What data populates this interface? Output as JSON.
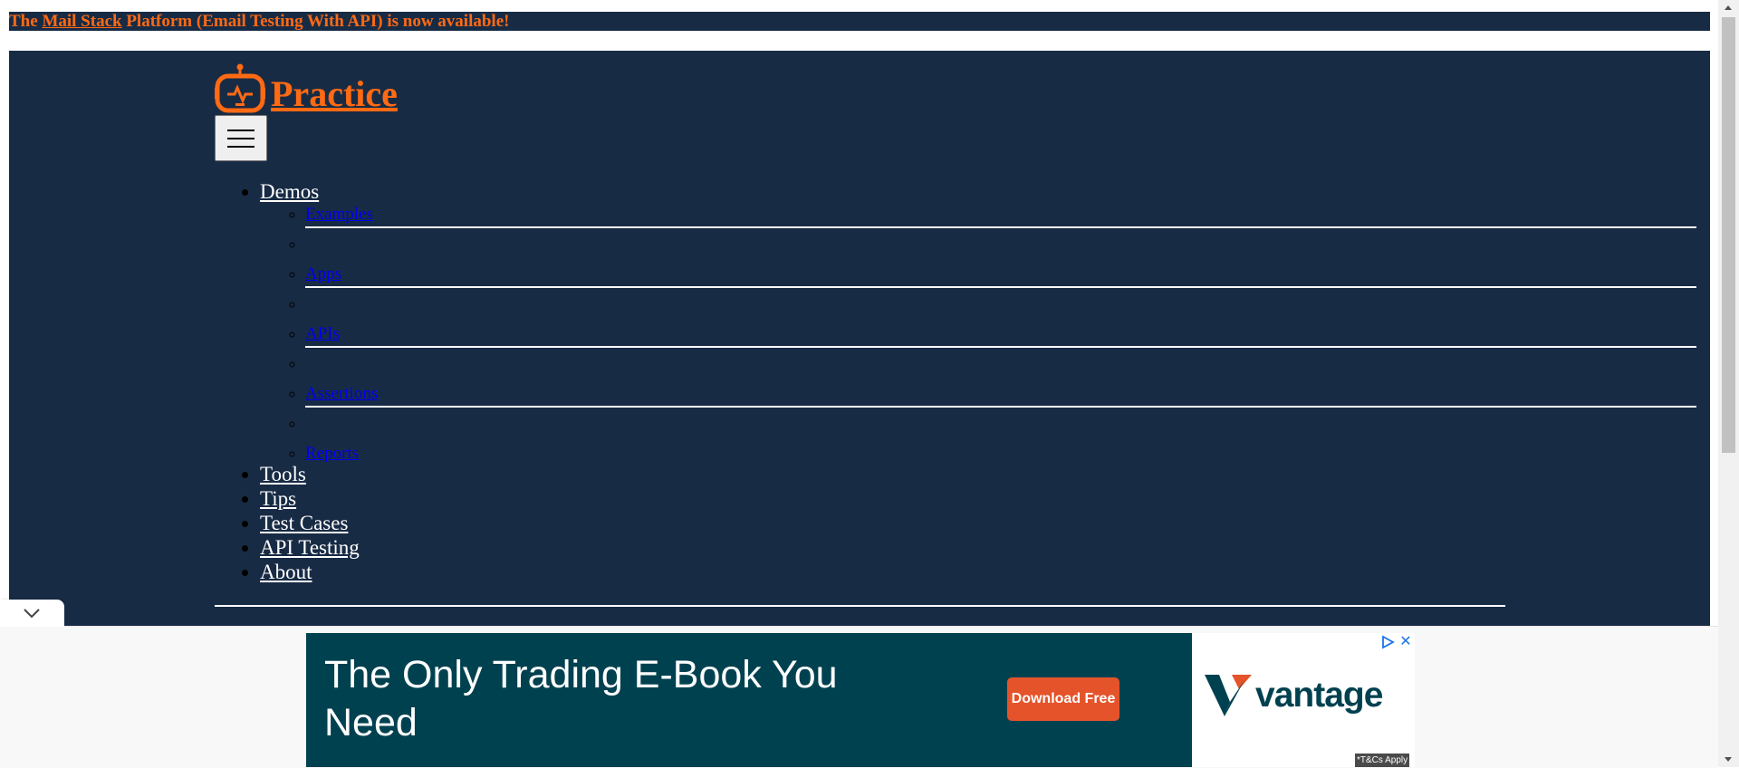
{
  "announcement": {
    "prefix": "The",
    "link": "Mail Stack",
    "suffix": "Platform (Email Testing With API) is now available!"
  },
  "header": {
    "brand": "Practice",
    "menu_toggle_icon": "hamburger-icon",
    "nav": [
      {
        "label": "Demos",
        "submenu": [
          "Examples",
          "Apps",
          "APIs",
          "Assertions",
          "Reports"
        ]
      },
      {
        "label": "Tools"
      },
      {
        "label": "Tips"
      },
      {
        "label": "Test Cases"
      },
      {
        "label": "API Testing"
      },
      {
        "label": "About"
      }
    ]
  },
  "collapse_tab": {
    "icon": "chevron-down-icon"
  },
  "ad": {
    "headline": "The Only Trading E-Book You Need",
    "cta": "Download Free",
    "brand": "vantage",
    "terms": "*T&Cs Apply",
    "choices_icon": "adchoices-icon",
    "close_icon": "close-icon"
  },
  "colors": {
    "navy": "#182b45",
    "orange": "#ff6a13",
    "ad_teal": "#004150",
    "cta_orange": "#e5532a",
    "link_blue": "#0000ee"
  }
}
